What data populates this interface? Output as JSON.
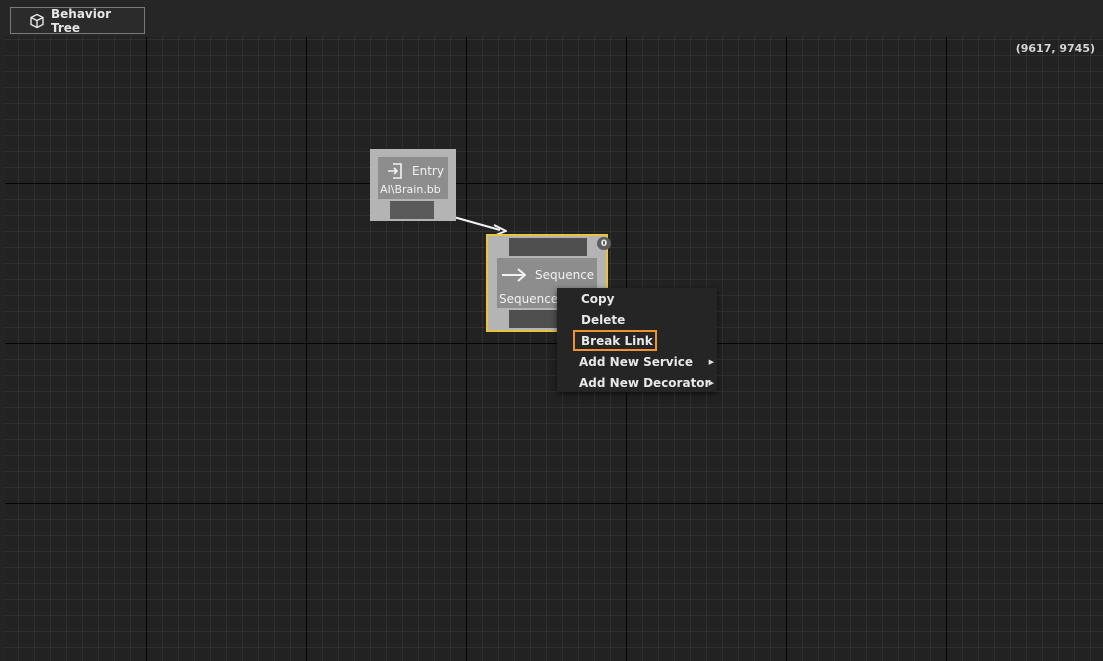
{
  "tab": {
    "title": "Behavior Tree",
    "icon": "cube-icon"
  },
  "canvas": {
    "coordinates": "(9617, 9745)"
  },
  "nodes": {
    "entry": {
      "title": "Entry",
      "subtitle": "AI\\Brain.bb",
      "icon": "entry-icon"
    },
    "sequence": {
      "title": "Sequence",
      "subtitle": "Sequence",
      "icon": "arrow-right-icon",
      "badge": "0",
      "selected_color": "#e8c440"
    }
  },
  "context_menu": {
    "items": [
      {
        "label": "Copy"
      },
      {
        "label": "Delete"
      },
      {
        "label": "Break Link",
        "highlighted": true
      },
      {
        "label": "Add New Service",
        "submenu": true
      },
      {
        "label": "Add New Decorator",
        "submenu": true
      }
    ],
    "highlight_color": "#f0922e"
  }
}
